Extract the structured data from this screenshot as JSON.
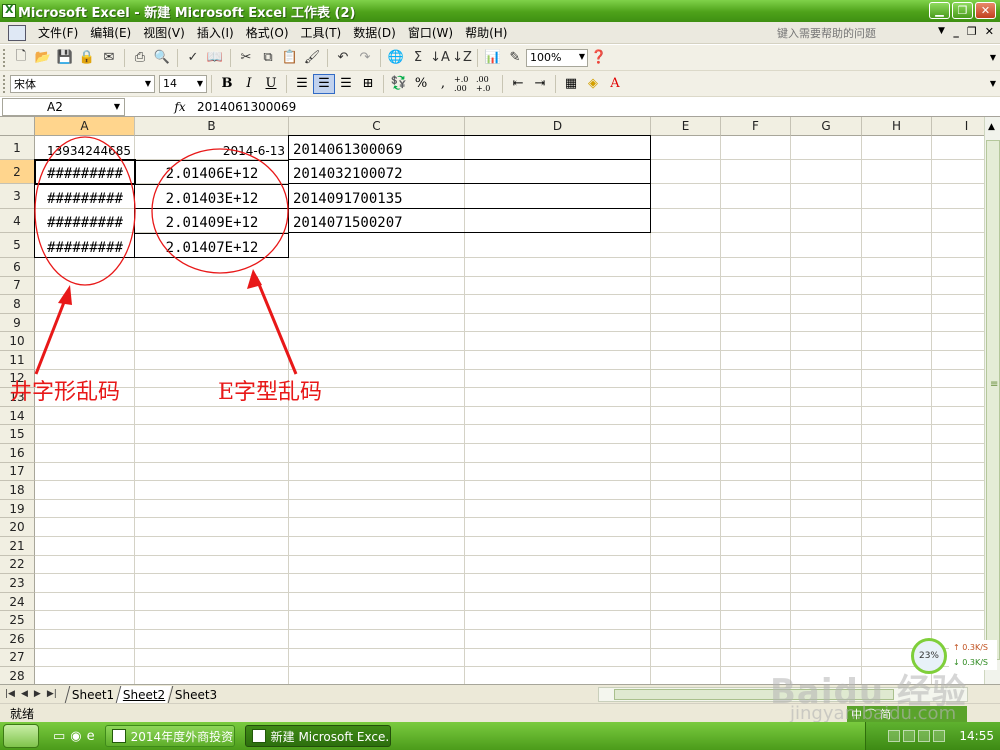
{
  "window": {
    "title": "Microsoft Excel - 新建 Microsoft Excel 工作表 (2)",
    "min": "▁",
    "max": "❐",
    "close": "✕"
  },
  "menu": {
    "items": [
      "文件(F)",
      "编辑(E)",
      "视图(V)",
      "插入(I)",
      "格式(O)",
      "工具(T)",
      "数据(D)",
      "窗口(W)",
      "帮助(H)"
    ],
    "help_placeholder": "键入需要帮助的问题"
  },
  "toolbar": {
    "zoom": "100%",
    "font_name": "宋体",
    "font_size": "14",
    "bold": "B",
    "italic": "I",
    "underline": "U",
    "percent": "%",
    "comma": ",",
    "inc_decimal": "+.0 .00",
    "dec_decimal": ".00 +.0",
    "sigma": "Σ"
  },
  "formula_bar": {
    "name_box": "A2",
    "fx": "fx",
    "value": "2014061300069"
  },
  "sheet": {
    "columns": [
      "A",
      "B",
      "C",
      "D",
      "E",
      "F",
      "G",
      "H",
      "I"
    ],
    "rows": [
      "1",
      "2",
      "3",
      "4",
      "5",
      "6",
      "7",
      "8",
      "9",
      "10",
      "11",
      "12",
      "13",
      "14",
      "15",
      "16",
      "17",
      "18",
      "19",
      "20",
      "21",
      "22",
      "23",
      "24",
      "25",
      "26",
      "27",
      "28"
    ],
    "selected_cell": "A2",
    "cells": {
      "A1": "13934244685",
      "B1": "2014-6-13",
      "C1": "2014061300069",
      "A2": "#########",
      "B2": "2.01406E+12",
      "C2": "2014032100072",
      "A3": "#########",
      "B3": "2.01403E+12",
      "C3": "2014091700135",
      "A4": "#########",
      "B4": "2.01409E+12",
      "C4": "2014071500207",
      "A5": "#########",
      "B5": "2.01407E+12"
    }
  },
  "annotations": {
    "label_hash": "井字形乱码",
    "label_e": "E字型乱码",
    "color": "#e81818"
  },
  "sheet_tabs": [
    "Sheet1",
    "Sheet2",
    "Sheet3"
  ],
  "active_tab": "Sheet2",
  "status": {
    "text": "就绪",
    "ime": "中 ⌒ 简"
  },
  "net_widget": {
    "percent": "23%",
    "up": "↑ 0.3K/S",
    "down": "↓ 0.3K/S"
  },
  "taskbar": {
    "tasks": [
      "2014年度外商投资...",
      "新建 Microsoft Exce..."
    ],
    "clock": "14:55"
  },
  "watermark": {
    "main": "Baidu 经验",
    "sub": "jingyan.baidu.com"
  }
}
